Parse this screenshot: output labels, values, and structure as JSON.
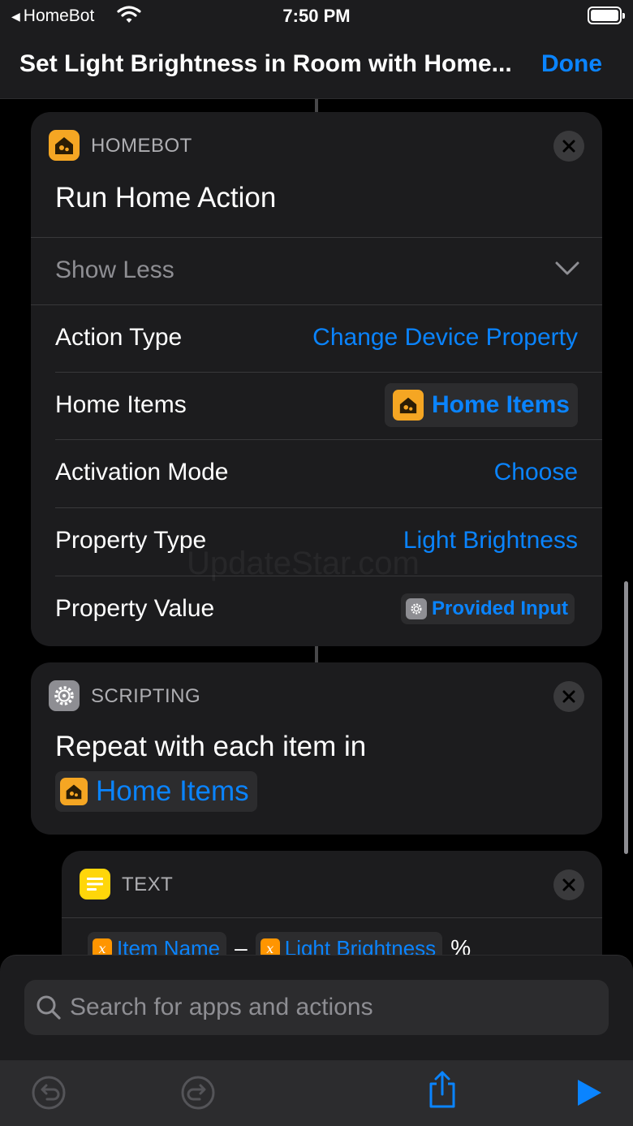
{
  "status_bar": {
    "back_app": "HomeBot",
    "time": "7:50 PM"
  },
  "nav": {
    "title": "Set Light Brightness in Room with Home...",
    "done_label": "Done"
  },
  "homebot_action": {
    "app_label": "HOMEBOT",
    "title": "Run Home Action",
    "show_less_label": "Show Less",
    "params": [
      {
        "label": "Action Type",
        "value": "Change Device Property"
      },
      {
        "label": "Home Items",
        "value": "Home Items"
      },
      {
        "label": "Activation Mode",
        "value": "Choose"
      },
      {
        "label": "Property Type",
        "value": "Light Brightness"
      },
      {
        "label": "Property Value",
        "value": "Provided Input"
      }
    ]
  },
  "scripting_action": {
    "app_label": "SCRIPTING",
    "title_line1": "Repeat with each item in",
    "variable": "Home Items"
  },
  "text_action": {
    "app_label": "TEXT",
    "var1": "Item Name",
    "separator": "–",
    "var2": "Light Brightness",
    "suffix": "%"
  },
  "search": {
    "placeholder": "Search for apps and actions"
  },
  "watermark": "UpdateStar.com",
  "icons": {
    "back": "back-triangle-icon",
    "wifi": "wifi-icon",
    "battery": "battery-icon",
    "homebot": "homebot-app-icon",
    "scripting": "gear-icon",
    "text": "text-lines-icon",
    "close": "close-icon",
    "chevron": "chevron-down-icon",
    "variable": "variable-x-icon",
    "search": "search-icon",
    "undo": "undo-icon",
    "redo": "redo-icon",
    "share": "share-icon",
    "play": "play-icon"
  },
  "colors": {
    "accent": "#0a84ff",
    "homebot": "#f5a623",
    "text_app": "#ffd60a",
    "variable": "#ff9500",
    "card_bg": "#1c1c1e"
  }
}
